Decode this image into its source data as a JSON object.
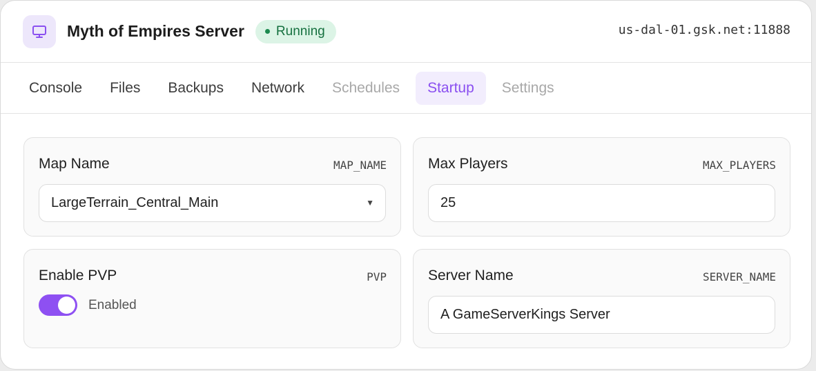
{
  "header": {
    "icon": "monitor-icon",
    "title": "Myth of Empires Server",
    "status": {
      "label": "Running",
      "color": "#1c8a4f"
    },
    "address": "us-dal-01.gsk.net:11888"
  },
  "tabs": [
    {
      "label": "Console",
      "state": "normal"
    },
    {
      "label": "Files",
      "state": "normal"
    },
    {
      "label": "Backups",
      "state": "normal"
    },
    {
      "label": "Network",
      "state": "normal"
    },
    {
      "label": "Schedules",
      "state": "disabled"
    },
    {
      "label": "Startup",
      "state": "active"
    },
    {
      "label": "Settings",
      "state": "disabled"
    }
  ],
  "variables": {
    "map_name": {
      "label": "Map Name",
      "key": "MAP_NAME",
      "value": "LargeTerrain_Central_Main"
    },
    "max_players": {
      "label": "Max Players",
      "key": "MAX_PLAYERS",
      "value": "25"
    },
    "pvp": {
      "label": "Enable PVP",
      "key": "PVP",
      "enabled": true,
      "state_label": "Enabled"
    },
    "server_name": {
      "label": "Server Name",
      "key": "SERVER_NAME",
      "value": "A GameServerKings Server"
    }
  },
  "accent_color": "#8e50f2"
}
